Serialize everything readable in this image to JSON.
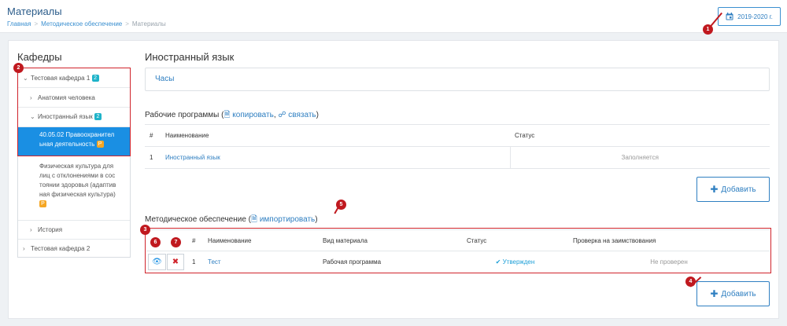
{
  "header": {
    "title": "Материалы",
    "breadcrumb": [
      "Главная",
      "Методическое обеспечение",
      "Материалы"
    ],
    "year_button": "2019-2020 г."
  },
  "sidebar": {
    "title": "Кафедры",
    "items": [
      {
        "label": "Тестовая кафедра 1",
        "badge": "2"
      },
      {
        "label": "Анатомия человека"
      },
      {
        "label": "Иностранный язык",
        "badge": "2"
      },
      {
        "label_lines": [
          "40.05.02 Правоохранител",
          "ьная деятельность"
        ],
        "badge": "Р"
      },
      {
        "label_lines": [
          "Физическая культура для",
          "лиц с отклонениями в сос",
          "тоянии здоровья (адаптив",
          "ная физическая культура)"
        ],
        "badge": "Р"
      },
      {
        "label": "История"
      },
      {
        "label": "Тестовая кафедра 2"
      }
    ]
  },
  "main": {
    "subject_title": "Иностранный язык",
    "hours_label": "Часы",
    "work_programs": {
      "title_prefix": "Рабочие программы (",
      "copy_label": "копировать",
      "comma": ",",
      "link_label": "связать",
      "title_suffix": ")",
      "columns": [
        "#",
        "Наименование",
        "Статус"
      ],
      "rows": [
        {
          "num": "1",
          "name": "Иностранный язык",
          "status": "Заполняется"
        }
      ],
      "add_label": "Добавить"
    },
    "methodical": {
      "title_prefix": "Методическое обеспечение (",
      "import_label": "импортировать",
      "title_suffix": ")",
      "columns": [
        "#",
        "Наименование",
        "Вид материала",
        "Статус",
        "Проверка на заимствования"
      ],
      "rows": [
        {
          "num": "1",
          "name": "Тест",
          "type": "Рабочая программа",
          "status": "Утвержден",
          "check": "Не проверен"
        }
      ],
      "add_label": "Добавить"
    }
  },
  "markers": [
    "1",
    "2",
    "3",
    "4",
    "5",
    "6",
    "7"
  ],
  "colors": {
    "accent": "#2f7fc1",
    "marker": "#c0191f",
    "active": "#1a8fe3",
    "badge_teal": "#1fb3c9",
    "badge_orange": "#f5a623"
  }
}
